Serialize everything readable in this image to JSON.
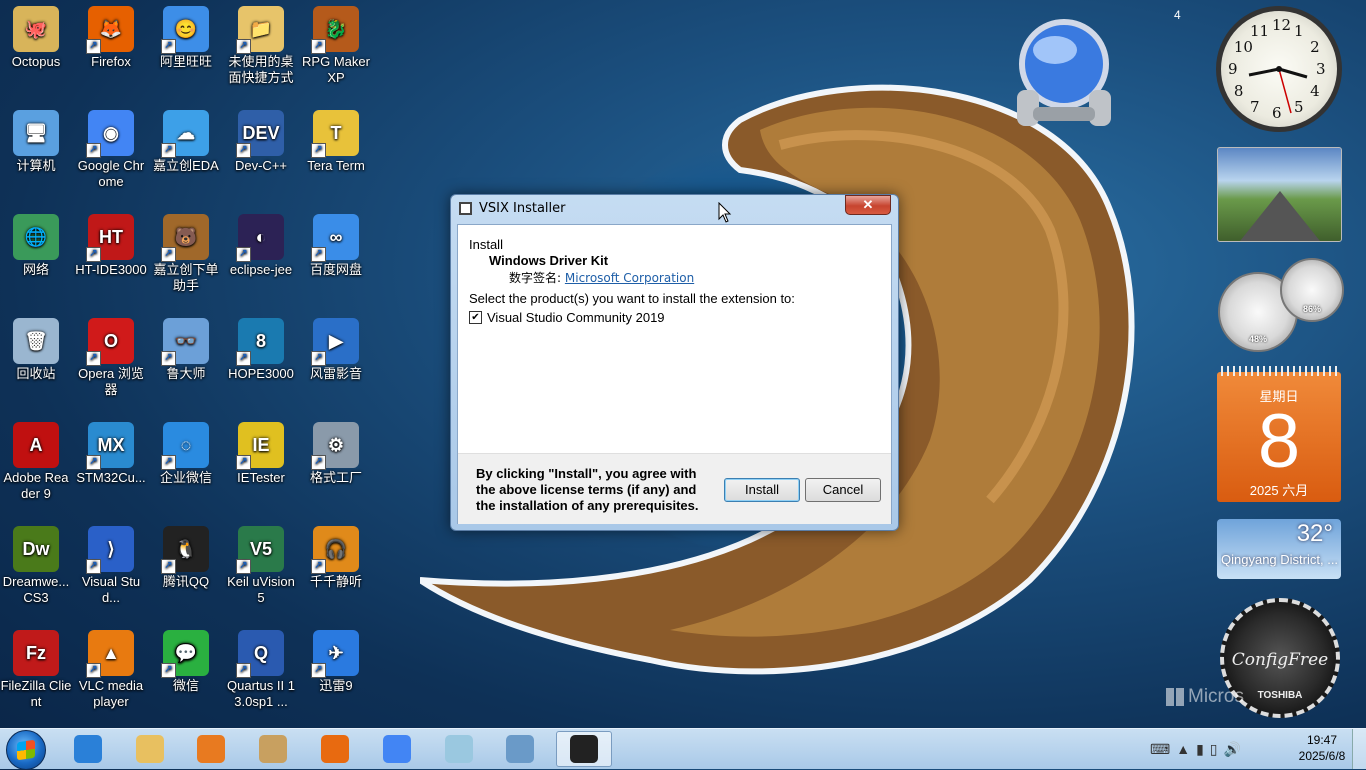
{
  "desktop": {
    "icons": [
      {
        "label": "Octopus",
        "color": "#d8b45a",
        "glyph": "🐙"
      },
      {
        "label": "Firefox",
        "color": "#e66000",
        "glyph": "🦊"
      },
      {
        "label": "阿里旺旺",
        "color": "#3d8ee8",
        "glyph": "😊"
      },
      {
        "label": "未使用的桌面快捷方式",
        "color": "#e7c46a",
        "glyph": "📁"
      },
      {
        "label": "RPG Maker XP",
        "color": "#b55a1b",
        "glyph": "🐉"
      },
      {
        "label": "计算机",
        "color": "#5aa0e0",
        "glyph": "🖥"
      },
      {
        "label": "Google Chrome",
        "color": "#4285f4",
        "glyph": "◉"
      },
      {
        "label": "嘉立创EDA",
        "color": "#3da0e8",
        "glyph": "☁"
      },
      {
        "label": "Dev-C++",
        "color": "#2f5fa8",
        "glyph": "DEV"
      },
      {
        "label": "Tera Term",
        "color": "#e8c23a",
        "glyph": "T"
      },
      {
        "label": "网络",
        "color": "#3a9a5a",
        "glyph": "🌐"
      },
      {
        "label": "HT-IDE3000",
        "color": "#c01818",
        "glyph": "HT"
      },
      {
        "label": "嘉立创下单助手",
        "color": "#a0682a",
        "glyph": "🐻"
      },
      {
        "label": "eclipse-jee",
        "color": "#2c2255",
        "glyph": "◐"
      },
      {
        "label": "百度网盘",
        "color": "#3a8de8",
        "glyph": "∞"
      },
      {
        "label": "回收站",
        "color": "#9ab6d0",
        "glyph": "🗑"
      },
      {
        "label": "Opera 浏览器",
        "color": "#d01a1a",
        "glyph": "O"
      },
      {
        "label": "鲁大师",
        "color": "#6ca0d8",
        "glyph": "👓"
      },
      {
        "label": "HOPE3000",
        "color": "#1a7ab0",
        "glyph": "8"
      },
      {
        "label": "风雷影音",
        "color": "#2a6fc8",
        "glyph": "▶"
      },
      {
        "label": "Adobe Reader 9",
        "color": "#c01010",
        "glyph": "A"
      },
      {
        "label": "STM32Cu...",
        "color": "#2a8bd0",
        "glyph": "MX"
      },
      {
        "label": "企业微信",
        "color": "#2a8be0",
        "glyph": "◌"
      },
      {
        "label": "IETester",
        "color": "#e0c020",
        "glyph": "IE"
      },
      {
        "label": "格式工厂",
        "color": "#8a9aaa",
        "glyph": "⚙"
      },
      {
        "label": "Dreamwe... CS3",
        "color": "#4a7a1a",
        "glyph": "Dw"
      },
      {
        "label": "Visual Stud...",
        "color": "#2a60c8",
        "glyph": "⟩"
      },
      {
        "label": "腾讯QQ",
        "color": "#222222",
        "glyph": "🐧"
      },
      {
        "label": "Keil uVision5",
        "color": "#2a7a4a",
        "glyph": "V5"
      },
      {
        "label": "千千静听",
        "color": "#e08a1a",
        "glyph": "🎧"
      },
      {
        "label": "FileZilla Client",
        "color": "#c01a1a",
        "glyph": "Fz"
      },
      {
        "label": "VLC media player",
        "color": "#e87a10",
        "glyph": "▲"
      },
      {
        "label": "微信",
        "color": "#2ab040",
        "glyph": "💬"
      },
      {
        "label": "Quartus II 13.0sp1 ...",
        "color": "#2a5ab0",
        "glyph": "Q"
      },
      {
        "label": "迅雷9",
        "color": "#2a7ae0",
        "glyph": "✈"
      }
    ]
  },
  "dialog": {
    "title": "VSIX Installer",
    "close_glyph": "✕",
    "install_header": "Install",
    "extension_name": "Windows Driver Kit",
    "signature_label": "数字签名:",
    "signature_publisher": "Microsoft Corporation",
    "select_prompt": "Select the product(s) you want to install the extension to:",
    "product": "Visual Studio Community 2019",
    "product_checked": true,
    "terms": "By clicking \"Install\", you agree with the above license terms (if any) and the installation of any prerequisites.",
    "install_button": "Install",
    "cancel_button": "Cancel"
  },
  "gadgets": {
    "badge": "4",
    "clock_numbers": [
      "12",
      "1",
      "2",
      "3",
      "4",
      "5",
      "6",
      "7",
      "8",
      "9",
      "10",
      "11"
    ],
    "cpu_meter": "48%",
    "mem_meter": "86%",
    "calendar": {
      "weekday": "星期日",
      "day": "8",
      "month": "2025 六月"
    },
    "weather": {
      "temp": "32°",
      "location": "Qingyang District, ..."
    },
    "configfree": {
      "text": "ConfigFree",
      "brand": "TOSHIBA"
    },
    "ms_watermark": "Micros"
  },
  "taskbar": {
    "time": "19:47",
    "date": "2025/6/8",
    "apps": [
      {
        "name": "internet-explorer",
        "color": "#2a80d8"
      },
      {
        "name": "file-explorer",
        "color": "#e8c060"
      },
      {
        "name": "media-player",
        "color": "#e87a20"
      },
      {
        "name": "paint",
        "color": "#c8a060"
      },
      {
        "name": "firefox",
        "color": "#e86a10"
      },
      {
        "name": "chrome",
        "color": "#4285f4"
      },
      {
        "name": "notepad",
        "color": "#9ac8e0"
      },
      {
        "name": "calculator",
        "color": "#6a9ac8"
      },
      {
        "name": "vsix-installer",
        "color": "#222222"
      }
    ]
  }
}
